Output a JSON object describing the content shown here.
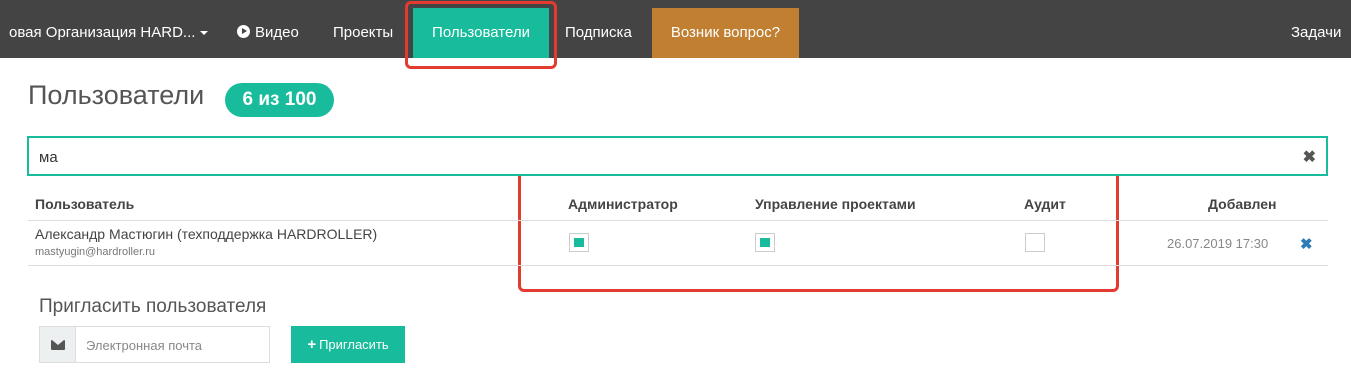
{
  "nav": {
    "org_label": "овая Организация HARD...",
    "video_label": "Видео",
    "projects_label": "Проекты",
    "users_label": "Пользователи",
    "subscription_label": "Подписка",
    "question_label": "Возник вопрос?",
    "tasks_label": "Задачи"
  },
  "page": {
    "title": "Пользователи",
    "badge": "6 из 100"
  },
  "search": {
    "value": "ма"
  },
  "table": {
    "headers": {
      "user": "Пользователь",
      "admin": "Администратор",
      "projects": "Управление проектами",
      "audit": "Аудит",
      "added": "Добавлен"
    },
    "rows": [
      {
        "name": "Александр Мастюгин (техподдержка HARDROLLER)",
        "email": "mastyugin@hardroller.ru",
        "admin": true,
        "projects": true,
        "audit": false,
        "added": "26.07.2019 17:30"
      }
    ]
  },
  "invite": {
    "title": "Пригласить пользователя",
    "placeholder": "Электронная почта",
    "button_label": "Пригласить"
  },
  "colors": {
    "accent": "#18bc9c",
    "question": "#c07f31",
    "navbar": "#444444",
    "highlight": "#e23b30"
  }
}
